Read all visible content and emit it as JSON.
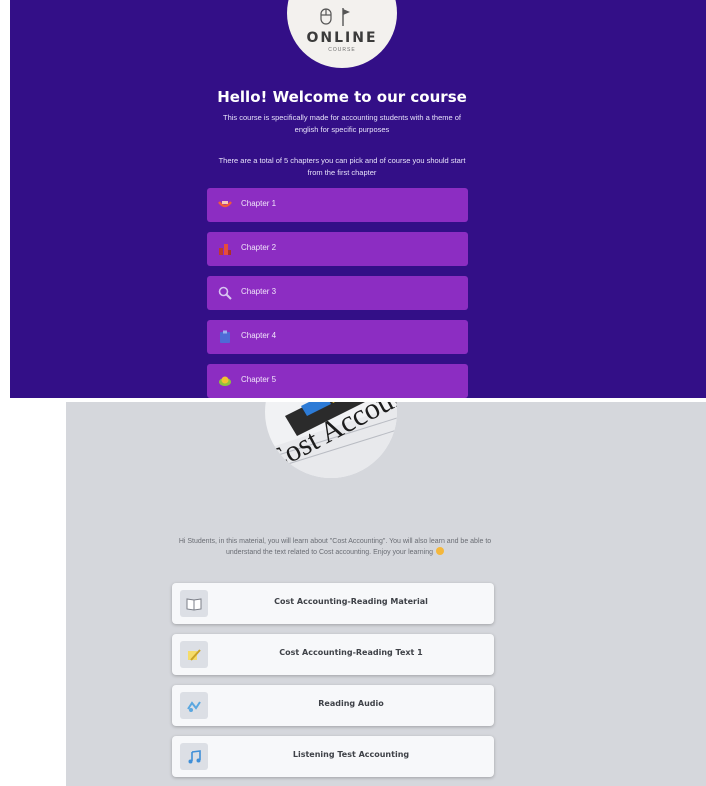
{
  "top": {
    "logo": {
      "title": "ONLINE",
      "subtitle": "COURSE"
    },
    "welcome_title": "Hello! Welcome to our course",
    "intro_line1": "This course is specifically made for accounting students with a theme of english for specific purposes",
    "intro_line2": "There are a total of 5 chapters you can pick and of course you should start from the first chapter",
    "chapters": [
      {
        "label": "Chapter 1",
        "icon": "tablet-icon"
      },
      {
        "label": "Chapter 2",
        "icon": "chart-icon"
      },
      {
        "label": "Chapter 3",
        "icon": "magnifier-icon"
      },
      {
        "label": "Chapter 4",
        "icon": "clipboard-icon"
      },
      {
        "label": "Chapter 5",
        "icon": "money-icon"
      }
    ],
    "colors": {
      "background": "#330f87",
      "chapter_button": "#8c2dc2"
    }
  },
  "bottom": {
    "hero_text": "Cost Account",
    "intro": "Hi Students, in this material, you will learn about \"Cost Accounting\". You will also learn and be able to understand the text related to Cost accounting. Enjoy your learning",
    "materials": [
      {
        "label": "Cost Accounting-Reading Material",
        "icon": "book-icon"
      },
      {
        "label": "Cost Accounting-Reading Text 1",
        "icon": "pencil-icon"
      },
      {
        "label": "Reading Audio",
        "icon": "audio-icon"
      },
      {
        "label": "Listening Test Accounting",
        "icon": "music-note-icon"
      }
    ],
    "colors": {
      "background": "#d5d7dc",
      "card": "#f7f8fa"
    }
  }
}
